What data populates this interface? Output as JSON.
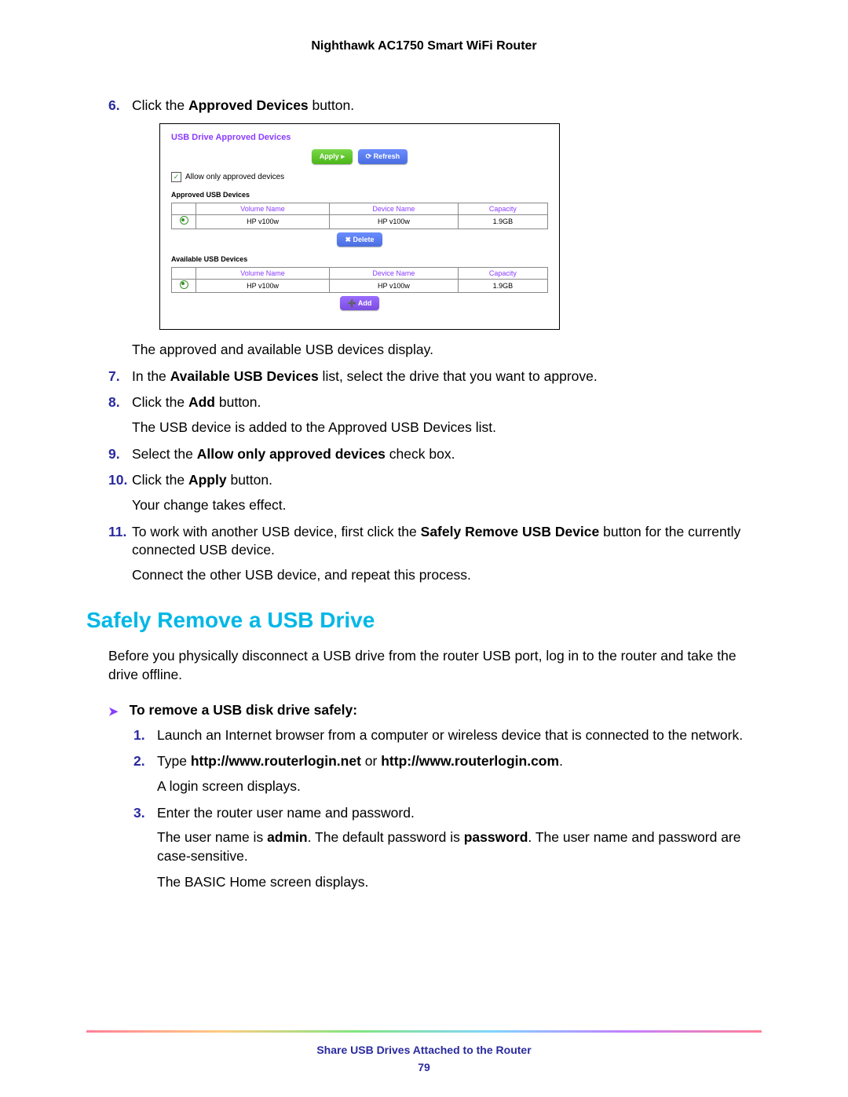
{
  "header": {
    "title": "Nighthawk AC1750 Smart WiFi Router"
  },
  "steps_a": [
    {
      "n": "6.",
      "lead": "Click the ",
      "bold": "Approved Devices",
      "tail": " button.",
      "after": "The approved and available USB devices display.",
      "has_panel": true
    },
    {
      "n": "7.",
      "lead": "In the ",
      "bold": "Available USB Devices",
      "tail": " list, select the drive that you want to approve."
    },
    {
      "n": "8.",
      "lead": "Click the ",
      "bold": "Add",
      "tail": " button.",
      "after": "The USB device is added to the Approved USB Devices list."
    },
    {
      "n": "9.",
      "lead": "Select the ",
      "bold": "Allow only approved devices",
      "tail": " check box."
    },
    {
      "n": "10.",
      "lead": "Click the ",
      "bold": "Apply",
      "tail": " button.",
      "after": "Your change takes effect."
    },
    {
      "n": "11.",
      "lead": "To work with another USB device, first click the ",
      "bold": "Safely Remove USB Device",
      "tail": " button for the currently connected USB device.",
      "after": "Connect the other USB device, and repeat this process."
    }
  ],
  "panel": {
    "title": "USB Drive Approved Devices",
    "apply": "Apply ▸",
    "refresh": "⟳ Refresh",
    "checkbox_label": "Allow only approved devices",
    "check_mark": "✓",
    "approved_hdr": "Approved USB Devices",
    "available_hdr": "Available USB Devices",
    "cols": {
      "vol": "Volume Name",
      "dev": "Device Name",
      "cap": "Capacity"
    },
    "row": {
      "vol": "HP v100w",
      "dev": "HP v100w",
      "cap": "1.9GB"
    },
    "delete": "✖ Delete",
    "add": "➕ Add"
  },
  "section_heading": "Safely Remove a USB Drive",
  "section_intro": "Before you physically disconnect a USB drive from the router USB port, log in to the router and take the drive offline.",
  "proc_head": "To remove a USB disk drive safely:",
  "steps_b": [
    {
      "n": "1.",
      "plain": "Launch an Internet browser from a computer or wireless device that is connected to the network."
    },
    {
      "n": "2.",
      "lead": "Type ",
      "bold": "http://www.routerlogin.net",
      "mid": " or ",
      "bold2": "http://www.routerlogin.com",
      "tail": ".",
      "after": "A login screen displays."
    },
    {
      "n": "3.",
      "plain": "Enter the router user name and password.",
      "after_rich": {
        "p1a": "The user name is ",
        "p1b": "admin",
        "p1c": ". The default password is ",
        "p1d": "password",
        "p1e": ". The user name and password are case-sensitive."
      },
      "after2": "The BASIC Home screen displays."
    }
  ],
  "footer": {
    "chapter": "Share USB Drives Attached to the Router",
    "page": "79"
  },
  "tri": "➤"
}
